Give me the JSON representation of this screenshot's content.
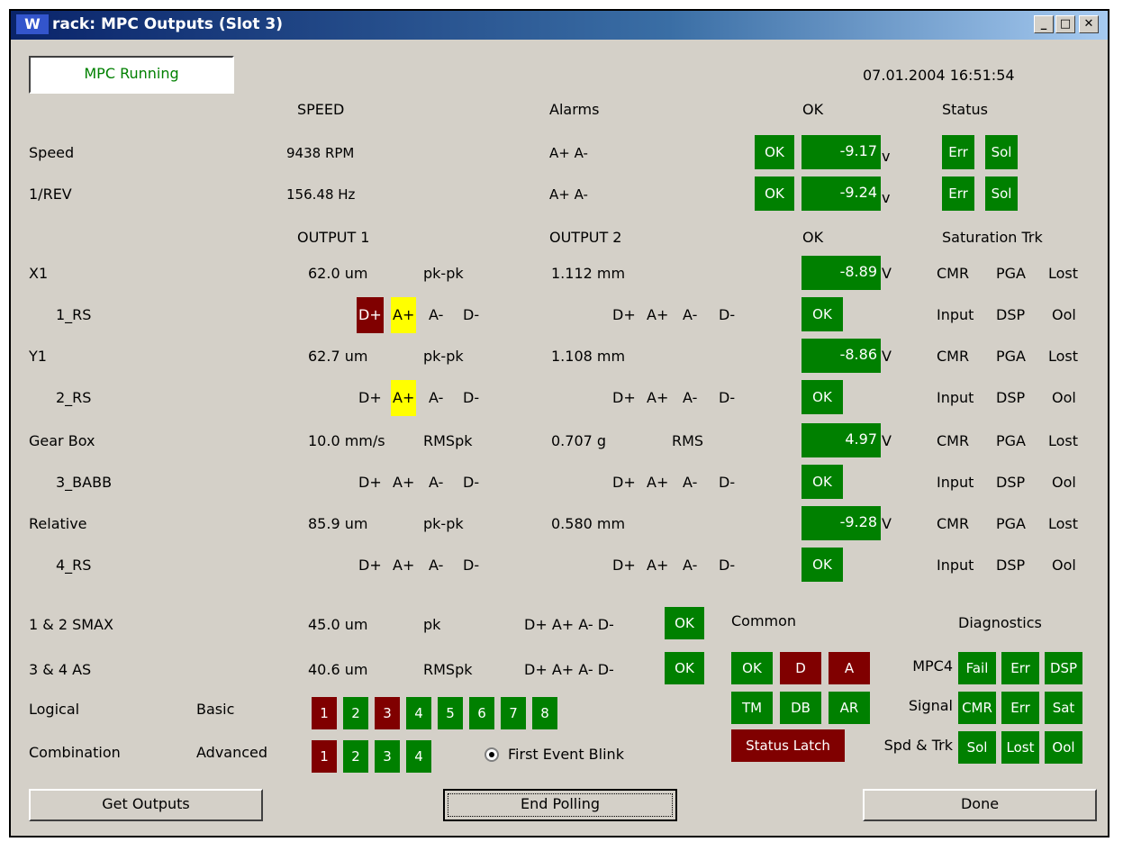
{
  "window": {
    "title": "rack: MPC Outputs (Slot 3)",
    "icon": "W",
    "min": "_",
    "max": "□",
    "close": "✕"
  },
  "status": "MPC Running",
  "datetime": "07.01.2004 16:51:54",
  "headers": {
    "speed": "SPEED",
    "alarms": "Alarms",
    "ok": "OK",
    "status": "Status",
    "output1": "OUTPUT 1",
    "output2": "OUTPUT 2",
    "ok2": "OK",
    "satTrk": "Saturation Trk"
  },
  "speed_rows": [
    {
      "label": "Speed",
      "value": "9438 RPM",
      "alarms": "A+ A-",
      "ok": "OK",
      "volt": "-9.17",
      "unit": "v",
      "err": "Err",
      "sol": "Sol"
    },
    {
      "label": "1/REV",
      "value": "156.48 Hz",
      "alarms": "A+ A-",
      "ok": "OK",
      "volt": "-9.24",
      "unit": "v",
      "err": "Err",
      "sol": "Sol"
    }
  ],
  "channels": [
    {
      "name": "X1",
      "v1": "62.0 um",
      "t1": "pk-pk",
      "v2": "1.112 mm",
      "t2": "",
      "volt": "-8.89",
      "unit": "V",
      "cmr": "CMR",
      "pga": "PGA",
      "lost": "Lost",
      "sub": "1_RS",
      "a1": [
        "D+",
        "A+",
        "A-",
        "D-"
      ],
      "a2": [
        "D+",
        "A+",
        "A-",
        "D-"
      ],
      "ok": "OK",
      "inp": "Input",
      "dsp": "DSP",
      "ool": "Ool"
    },
    {
      "name": "Y1",
      "v1": "62.7 um",
      "t1": "pk-pk",
      "v2": "1.108 mm",
      "t2": "",
      "volt": "-8.86",
      "unit": "V",
      "cmr": "CMR",
      "pga": "PGA",
      "lost": "Lost",
      "sub": "2_RS",
      "a1": [
        "D+",
        "A+",
        "A-",
        "D-"
      ],
      "a2": [
        "D+",
        "A+",
        "A-",
        "D-"
      ],
      "ok": "OK",
      "inp": "Input",
      "dsp": "DSP",
      "ool": "Ool"
    },
    {
      "name": "Gear Box",
      "v1": "10.0 mm/s",
      "t1": "RMSpk",
      "v2": "0.707 g",
      "t2": "RMS",
      "volt": "4.97",
      "unit": "V",
      "cmr": "CMR",
      "pga": "PGA",
      "lost": "Lost",
      "sub": "3_BABB",
      "a1": [
        "D+",
        "A+",
        "A-",
        "D-"
      ],
      "a2": [
        "D+",
        "A+",
        "A-",
        "D-"
      ],
      "ok": "OK",
      "inp": "Input",
      "dsp": "DSP",
      "ool": "Ool"
    },
    {
      "name": "Relative",
      "v1": "85.9 um",
      "t1": "pk-pk",
      "v2": "0.580 mm",
      "t2": "",
      "volt": "-9.28",
      "unit": "V",
      "cmr": "CMR",
      "pga": "PGA",
      "lost": "Lost",
      "sub": "4_RS",
      "a1": [
        "D+",
        "A+",
        "A-",
        "D-"
      ],
      "a2": [
        "D+",
        "A+",
        "A-",
        "D-"
      ],
      "ok": "OK",
      "inp": "Input",
      "dsp": "DSP",
      "ool": "Ool"
    }
  ],
  "combined": [
    {
      "label": "1 & 2  SMAX",
      "value": "45.0 um",
      "type": "pk",
      "alarms": "D+ A+ A-  D-",
      "ok": "OK"
    },
    {
      "label": "3 & 4  AS",
      "value": "40.6 um",
      "type": "RMSpk",
      "alarms": "D+ A+ A-  D-",
      "ok": "OK"
    }
  ],
  "logical": {
    "label1": "Logical",
    "label2": "Combination",
    "basic": "Basic",
    "advanced": "Advanced",
    "basic_items": [
      "1",
      "2",
      "3",
      "4",
      "5",
      "6",
      "7",
      "8"
    ],
    "advanced_items": [
      "1",
      "2",
      "3",
      "4"
    ],
    "radio_label": "First Event Blink"
  },
  "common": {
    "title": "Common",
    "items": [
      "OK",
      "D",
      "A",
      "TM",
      "DB",
      "AR"
    ],
    "latch": "Status Latch"
  },
  "diagnostics": {
    "title": "Diagnostics",
    "rows": [
      {
        "label": "MPC4",
        "items": [
          "Fail",
          "Err",
          "DSP"
        ]
      },
      {
        "label": "Signal",
        "items": [
          "CMR",
          "Err",
          "Sat"
        ]
      },
      {
        "label": "Spd & Trk",
        "items": [
          "Sol",
          "Lost",
          "Ool"
        ]
      }
    ]
  },
  "buttons": {
    "get": "Get Outputs",
    "end": "End Polling",
    "done": "Done"
  },
  "colors": {
    "green": "#008000",
    "red": "#800000",
    "yellow": "#ffff00",
    "face": "#d4d0c8"
  }
}
